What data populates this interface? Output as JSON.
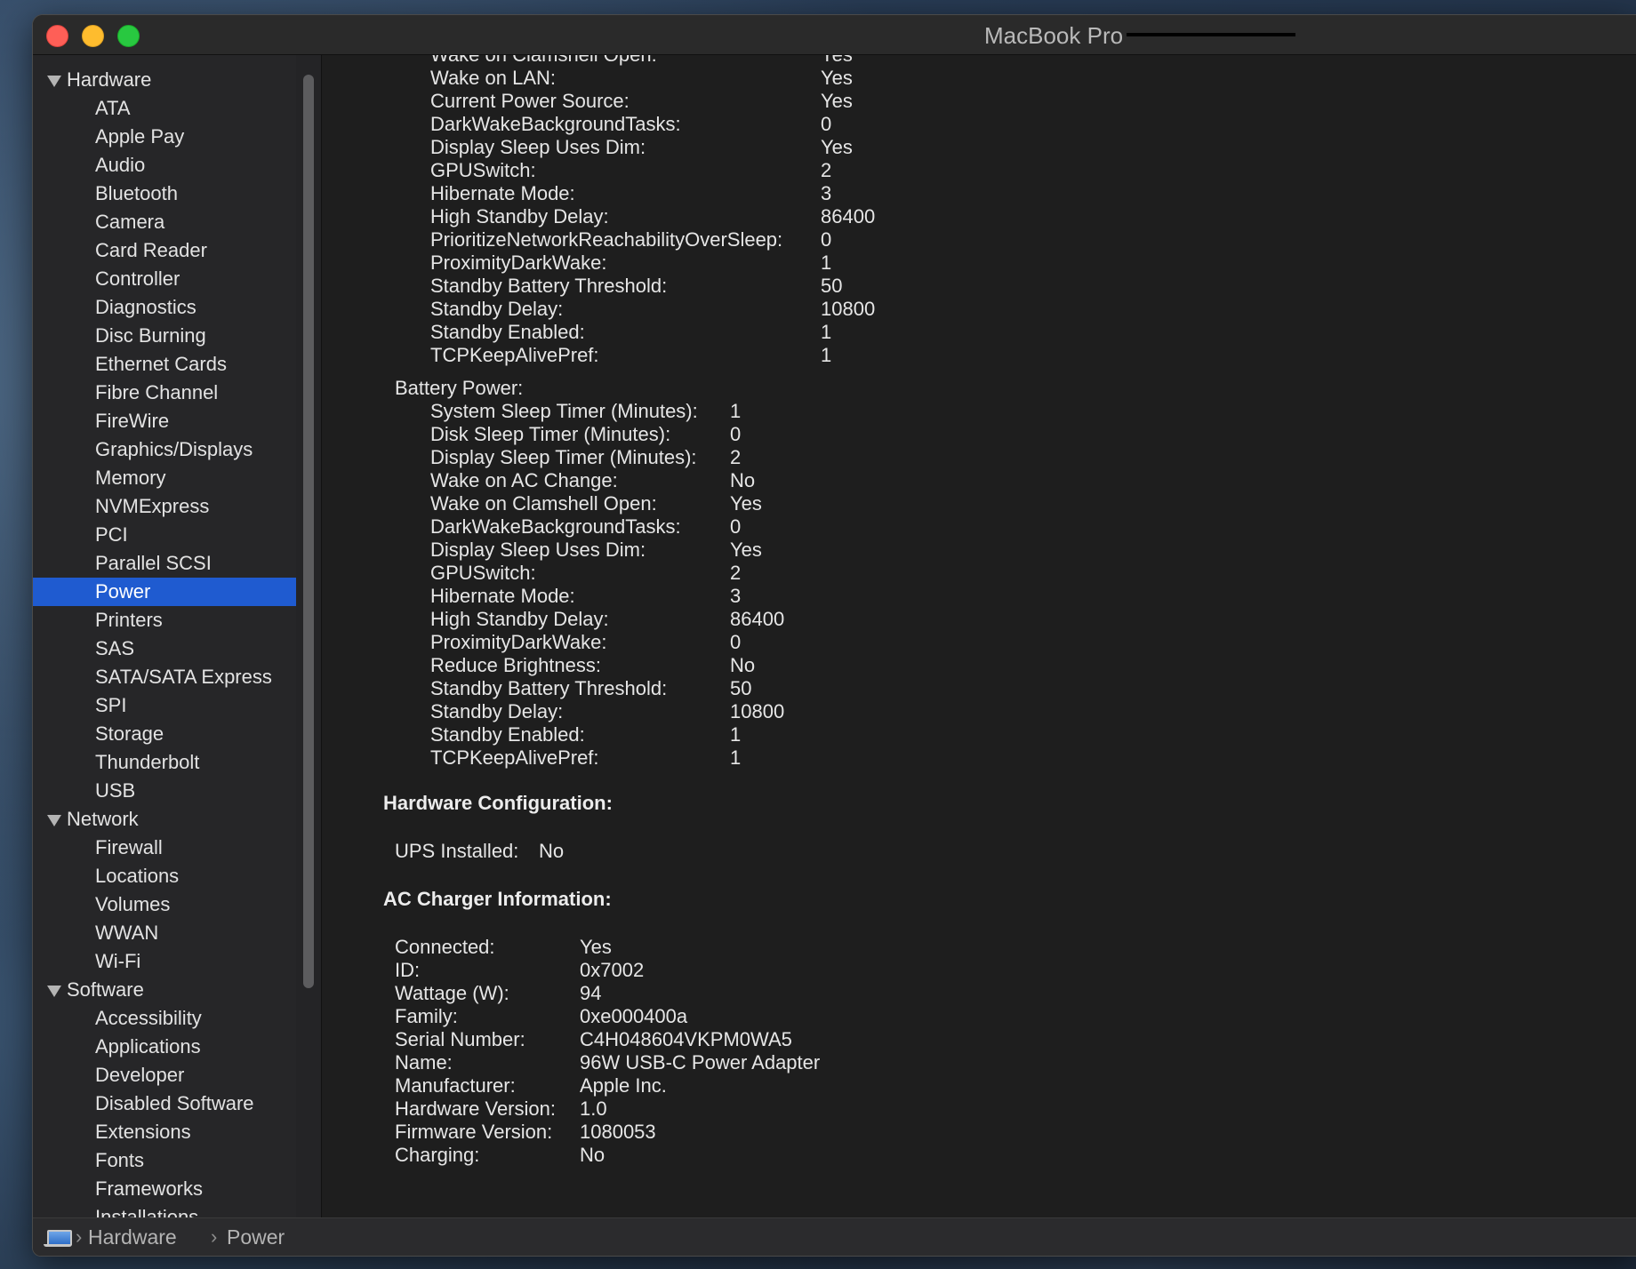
{
  "window": {
    "title": "MacBook Pro"
  },
  "sidebar": {
    "categories": [
      {
        "label": "Hardware",
        "items": [
          "ATA",
          "Apple Pay",
          "Audio",
          "Bluetooth",
          "Camera",
          "Card Reader",
          "Controller",
          "Diagnostics",
          "Disc Burning",
          "Ethernet Cards",
          "Fibre Channel",
          "FireWire",
          "Graphics/Displays",
          "Memory",
          "NVMExpress",
          "PCI",
          "Parallel SCSI",
          "Power",
          "Printers",
          "SAS",
          "SATA/SATA Express",
          "SPI",
          "Storage",
          "Thunderbolt",
          "USB"
        ]
      },
      {
        "label": "Network",
        "items": [
          "Firewall",
          "Locations",
          "Volumes",
          "WWAN",
          "Wi-Fi"
        ]
      },
      {
        "label": "Software",
        "items": [
          "Accessibility",
          "Applications",
          "Developer",
          "Disabled Software",
          "Extensions",
          "Fonts",
          "Frameworks",
          "Installations"
        ]
      }
    ],
    "selected": "Power"
  },
  "content": {
    "ac_power_partial": [
      {
        "key": "Wake on Clamshell Open:",
        "value": "Yes"
      },
      {
        "key": "Wake on LAN:",
        "value": "Yes"
      },
      {
        "key": "Current Power Source:",
        "value": "Yes"
      },
      {
        "key": "DarkWakeBackgroundTasks:",
        "value": "0"
      },
      {
        "key": "Display Sleep Uses Dim:",
        "value": "Yes"
      },
      {
        "key": "GPUSwitch:",
        "value": "2"
      },
      {
        "key": "Hibernate Mode:",
        "value": "3"
      },
      {
        "key": "High Standby Delay:",
        "value": "86400"
      },
      {
        "key": "PrioritizeNetworkReachabilityOverSleep:",
        "value": "0"
      },
      {
        "key": "ProximityDarkWake:",
        "value": "1"
      },
      {
        "key": "Standby Battery Threshold:",
        "value": "50"
      },
      {
        "key": "Standby Delay:",
        "value": "10800"
      },
      {
        "key": "Standby Enabled:",
        "value": "1"
      },
      {
        "key": "TCPKeepAlivePref:",
        "value": "1"
      }
    ],
    "battery_power_label": "Battery Power:",
    "battery_power": [
      {
        "key": "System Sleep Timer (Minutes):",
        "value": "1"
      },
      {
        "key": "Disk Sleep Timer (Minutes):",
        "value": "0"
      },
      {
        "key": "Display Sleep Timer (Minutes):",
        "value": "2"
      },
      {
        "key": "Wake on AC Change:",
        "value": "No"
      },
      {
        "key": "Wake on Clamshell Open:",
        "value": "Yes"
      },
      {
        "key": "DarkWakeBackgroundTasks:",
        "value": "0"
      },
      {
        "key": "Display Sleep Uses Dim:",
        "value": "Yes"
      },
      {
        "key": "GPUSwitch:",
        "value": "2"
      },
      {
        "key": "Hibernate Mode:",
        "value": "3"
      },
      {
        "key": "High Standby Delay:",
        "value": "86400"
      },
      {
        "key": "ProximityDarkWake:",
        "value": "0"
      },
      {
        "key": "Reduce Brightness:",
        "value": "No"
      },
      {
        "key": "Standby Battery Threshold:",
        "value": "50"
      },
      {
        "key": "Standby Delay:",
        "value": "10800"
      },
      {
        "key": "Standby Enabled:",
        "value": "1"
      },
      {
        "key": "TCPKeepAlivePref:",
        "value": "1"
      }
    ],
    "hardware_config_heading": "Hardware Configuration:",
    "hardware_config": [
      {
        "key": "UPS Installed:",
        "value": "No"
      }
    ],
    "ac_charger_heading": "AC Charger Information:",
    "ac_charger": [
      {
        "key": "Connected:",
        "value": "Yes"
      },
      {
        "key": "ID:",
        "value": "0x7002"
      },
      {
        "key": "Wattage (W):",
        "value": "94"
      },
      {
        "key": "Family:",
        "value": "0xe000400a"
      },
      {
        "key": "Serial Number:",
        "value": "C4H048604VKPM0WA5"
      },
      {
        "key": "Name:",
        "value": "96W USB-C Power Adapter"
      },
      {
        "key": "Manufacturer:",
        "value": "Apple Inc."
      },
      {
        "key": "Hardware Version:",
        "value": "1.0"
      },
      {
        "key": "Firmware Version:",
        "value": "1080053"
      },
      {
        "key": "Charging:",
        "value": "No"
      }
    ]
  },
  "pathbar": {
    "icon": "computer-icon",
    "crumbs": [
      "Hardware",
      "Power"
    ]
  },
  "colors": {
    "selection": "#1f5bd0",
    "window_bg": "#1e1e1e",
    "sidebar_bg": "#262628"
  }
}
